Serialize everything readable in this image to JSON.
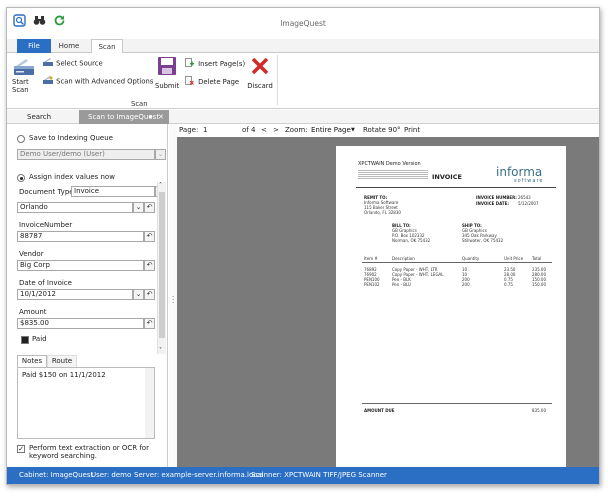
{
  "app": {
    "title": "ImageQuest"
  },
  "ribbon": {
    "tabs": [
      "File",
      "Home",
      "Scan"
    ],
    "start_scan": "Start Scan",
    "select_source": "Select Source",
    "scan_advanced": "Scan with Advanced Options",
    "submit": "Submit",
    "insert_pages": "Insert Page(s)",
    "delete_page": "Delete Page",
    "discard": "Discard",
    "group_label": "Scan"
  },
  "panes": {
    "search": "Search",
    "scan_tab": "Scan to ImageQuest",
    "pin": "▪",
    "close": "✕"
  },
  "form": {
    "save_queue": "Save to Indexing Queue",
    "queue_user": "Demo User/demo (User)",
    "assign_index": "Assign index values now",
    "doc_type_label": "Document Type:",
    "doc_type_value": "Invoice",
    "city_value": "Orlando",
    "invoice_number_label": "InvoiceNumber",
    "invoice_number_value": "88787",
    "vendor_label": "Vendor",
    "vendor_value": "Big Corp",
    "date_label": "Date of Invoice",
    "date_value": "10/1/2012",
    "amount_label": "Amount",
    "amount_value": "$835.00",
    "paid_label": "Paid",
    "notes_tab": "Notes",
    "route_tab": "Route",
    "notes_text": "Paid $150 on 11/1/2012",
    "ocr_label": "Perform text extraction or OCR for keyword searching."
  },
  "viewer": {
    "page_label": "Page:",
    "page_value": "1",
    "of_label": "of 4",
    "prev": "<",
    "next": ">",
    "zoom_label": "Zoom:",
    "zoom_value": "Entire Page",
    "rotate": "Rotate 90°",
    "print": "Print"
  },
  "document": {
    "version_title": "XPCTWAIN Demo Version",
    "heading": "INVOICE",
    "logo_main": "informa",
    "logo_sub": "software",
    "remit_to": "REMIT TO:",
    "remit_lines": [
      "Informa Software",
      "115 Baker Street",
      "Orlando, FL 32830"
    ],
    "invoice_number_label": "INVOICE NUMBER:",
    "invoice_number": "26543",
    "invoice_date_label": "INVOICE DATE:",
    "invoice_date": "5/12/2007",
    "bill_to": "BILL TO:",
    "bill_lines": [
      "GB Graphics",
      "P.O. Box 102332",
      "Norman, OK 75432"
    ],
    "ship_to": "SHIP TO:",
    "ship_lines": [
      "GB Graphics",
      "345 Oak Parkway",
      "Stillwater, OK 75432"
    ],
    "columns": [
      "Item #",
      "Description",
      "Quantity",
      "Unit Price",
      "Total"
    ],
    "rows": [
      [
        "76892",
        "Copy Paper - WHT, LTR",
        "10",
        "23.50",
        "235.00"
      ],
      [
        "76902",
        "Copy Paper - WHT, LEGAL",
        "10",
        "28.00",
        "280.00"
      ],
      [
        "PEN100",
        "Pen - BLK",
        "200",
        "0.75",
        "150.00"
      ],
      [
        "PEN102",
        "Pen - BLU",
        "200",
        "0.75",
        "150.00"
      ]
    ],
    "amount_due_label": "AMOUNT DUE",
    "amount_due": "835.00"
  },
  "status": {
    "cabinet": "Cabinet: ImageQuest",
    "user": "User: demo",
    "server": "Server: example-server.informa.local",
    "scanner": "Scanner: XPCTWAIN TIFF/JPEG Scanner"
  }
}
